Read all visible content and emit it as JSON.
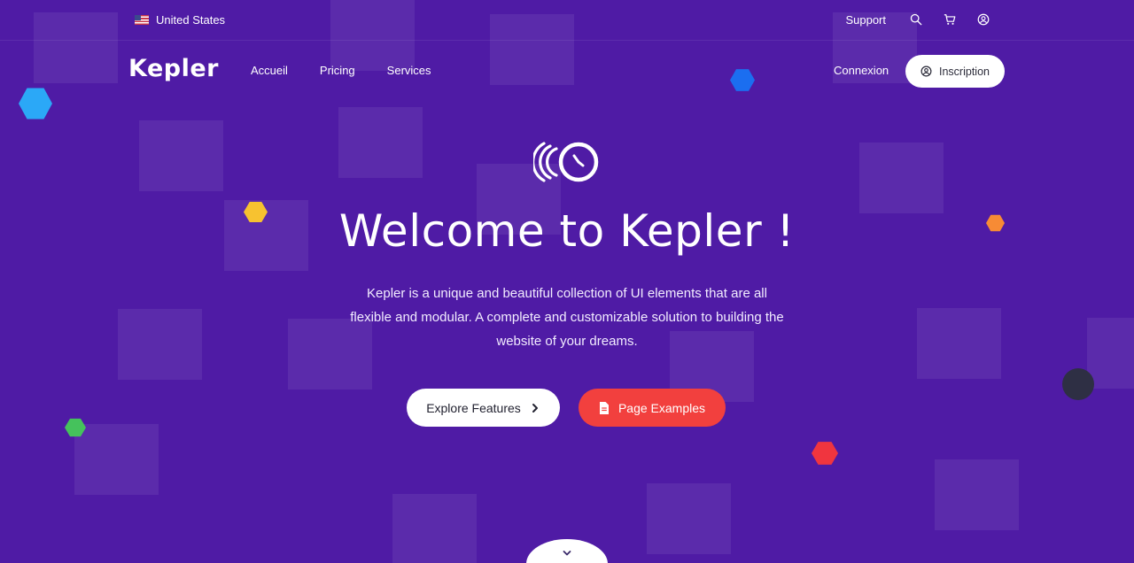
{
  "topbar": {
    "locale": "United States",
    "support_label": "Support",
    "icons": [
      "search-icon",
      "cart-icon",
      "user-icon"
    ]
  },
  "nav": {
    "logo": "Kepler",
    "items": [
      {
        "label": "Accueil"
      },
      {
        "label": "Pricing"
      },
      {
        "label": "Services"
      }
    ],
    "login_label": "Connexion",
    "signup_label": "Inscription"
  },
  "hero": {
    "title": "Welcome to Kepler !",
    "description": "Kepler is a unique and beautiful collection of UI elements that are all flexible and modular. A complete and customizable solution to building the website of your dreams.",
    "primary_button": "Explore Features",
    "secondary_button": "Page Examples"
  },
  "colors": {
    "background": "#4f1ba5",
    "accent_red": "#f2403e",
    "white": "#ffffff"
  }
}
